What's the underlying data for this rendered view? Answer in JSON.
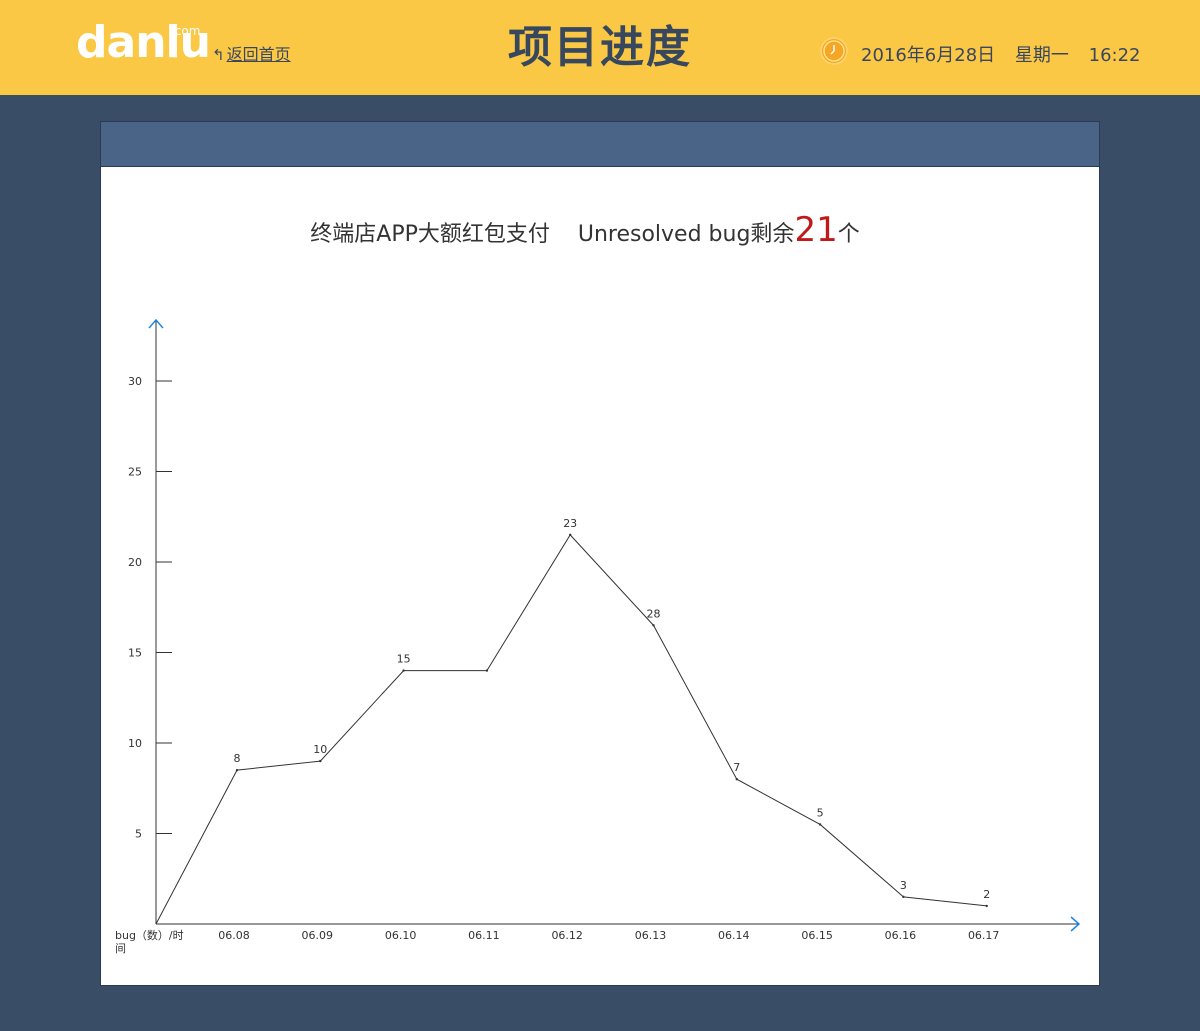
{
  "header": {
    "logo_text": "danlu",
    "logo_domain": ".com",
    "back_icon": "reply-arrow-icon",
    "back_label": "返回首页",
    "title": "项目进度",
    "clock_icon": "clock-icon",
    "date": "2016年6月28日",
    "weekday": "星期一",
    "time": "16:22"
  },
  "colors": {
    "topbar": "#fac845",
    "background": "#3a4d66",
    "panel_header": "#4a6487",
    "axis_arrow": "#1e88e5",
    "highlight_count": "#c0191a"
  },
  "chart_title": {
    "prefix": "终端店APP大额红包支付",
    "middle": "Unresolved bug剩余",
    "count": "21",
    "suffix": "个"
  },
  "chart_data": {
    "type": "line",
    "xlabel": "bug（数）/时间",
    "categories": [
      "06.08",
      "06.09",
      "06.10",
      "06.11",
      "06.12",
      "06.13",
      "06.14",
      "06.15",
      "06.16",
      "06.17"
    ],
    "points": [
      {
        "x": "06.08",
        "y": 8.5,
        "label": "8"
      },
      {
        "x": "06.09",
        "y": 9.0,
        "label": "10"
      },
      {
        "x": "06.10",
        "y": 14.0,
        "label": "15"
      },
      {
        "x": "06.11",
        "y": 14.0,
        "label": ""
      },
      {
        "x": "06.12",
        "y": 21.5,
        "label": "23"
      },
      {
        "x": "06.13",
        "y": 16.5,
        "label": "28"
      },
      {
        "x": "06.14",
        "y": 8.0,
        "label": "7"
      },
      {
        "x": "06.15",
        "y": 5.5,
        "label": "5"
      },
      {
        "x": "06.16",
        "y": 1.5,
        "label": "3"
      },
      {
        "x": "06.17",
        "y": 1.0,
        "label": "2"
      }
    ],
    "yticks": [
      5,
      10,
      15,
      20,
      25,
      30
    ],
    "ylim": [
      0,
      30
    ],
    "grid": false
  }
}
